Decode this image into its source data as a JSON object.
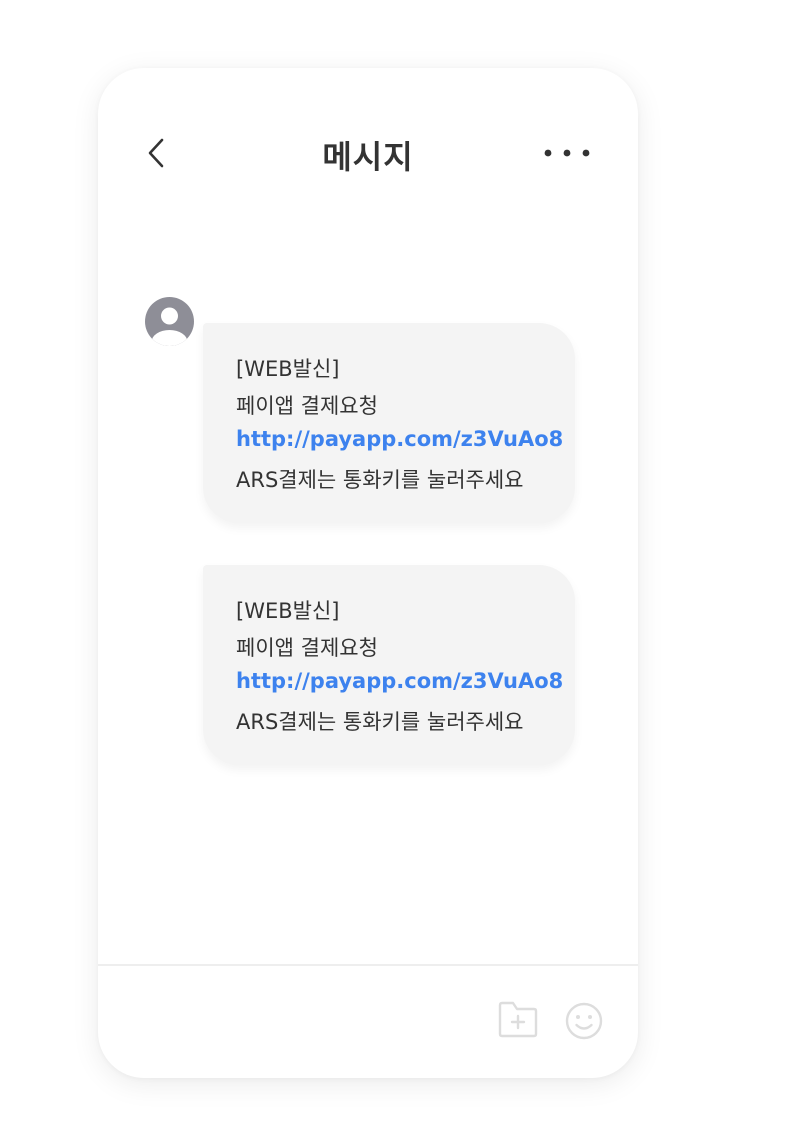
{
  "header": {
    "title": "메시지",
    "back_icon": "chevron-left-icon",
    "more_icon": "more-horizontal-icon"
  },
  "conversation": {
    "avatar_icon": "person-avatar-icon",
    "messages": [
      {
        "line1": "[WEB발신]",
        "line2": "페이앱 결제요청",
        "link": "http://payapp.com/z3VuAo8",
        "line4": "ARS결제는 통화키를 눌러주세요"
      },
      {
        "line1": "[WEB발신]",
        "line2": "페이앱 결제요청",
        "link": "http://payapp.com/z3VuAo8",
        "line4": "ARS결제는 통화키를 눌러주세요"
      }
    ]
  },
  "input_bar": {
    "attach_icon": "folder-add-icon",
    "emoji_icon": "smiley-icon"
  },
  "colors": {
    "link": "#3d82ee",
    "bubble": "#f4f4f4",
    "text": "#333333",
    "avatar": "#8e8e97",
    "icon_muted": "#dddddd"
  }
}
